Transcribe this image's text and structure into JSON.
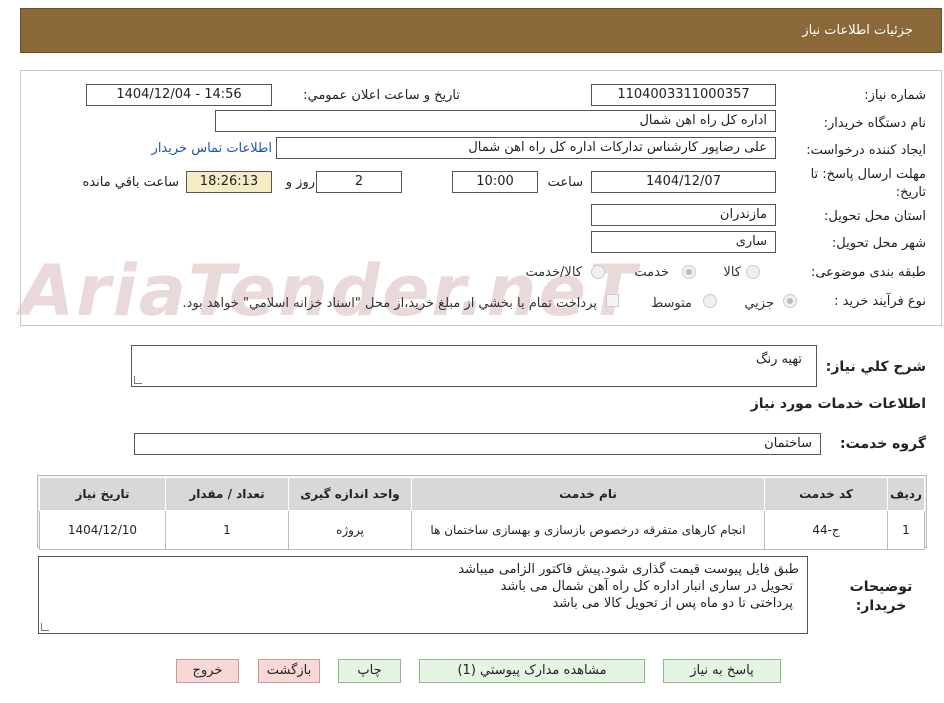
{
  "header": {
    "title": "جزئيات اطلاعات نياز"
  },
  "watermark": "AriaTender.neT",
  "fields": {
    "need_number_label": "شماره نياز:",
    "need_number": "1104003311000357",
    "announce_label": "تاريخ و ساعت اعلان عمومي:",
    "announce_value": "1404/12/04 - 14:56",
    "buyer_org_label": "نام دستگاه خريدار:",
    "buyer_org": "اداره كل راه اهن شمال",
    "creator_label": "ايجاد كننده درخواست:",
    "creator": "علی رضاپور کارشناس تدارکات اداره کل راه اهن شمال",
    "contact_link": "اطلاعات تماس خريدار",
    "deadline_label": "مهلت ارسال پاسخ: تا تاريخ:",
    "deadline_date": "1404/12/07",
    "time_label": "ساعت",
    "deadline_time": "10:00",
    "days": "2",
    "days_label": "روز و",
    "remaining_time": "18:26:13",
    "remaining_label": "ساعت باقي مانده",
    "province_label": "استان محل تحويل:",
    "province": "مازندران",
    "city_label": "شهر محل تحويل:",
    "city": "ساری",
    "category_label": "طبقه بندی موضوعی:",
    "category_options": [
      "كالا",
      "خدمت",
      "كالا/خدمت"
    ],
    "process_label": "نوع فرآيند خريد :",
    "process_options": [
      "جزيي",
      "متوسط"
    ],
    "payment_note": "پرداخت تمام يا بخشي از مبلغ خريد،از محل \"اسناد خزانه اسلامي\" خواهد بود."
  },
  "summary": {
    "label": "شرح كلي نياز:",
    "value": "تهیه رنگ"
  },
  "services_title": "اطلاعات خدمات مورد نياز",
  "service_group": {
    "label": "گروه خدمت:",
    "value": "ساختمان"
  },
  "table": {
    "headers": [
      "رديف",
      "كد خدمت",
      "نام خدمت",
      "واحد اندازه گيری",
      "تعداد / مقدار",
      "تاريخ نياز"
    ],
    "rows": [
      [
        "1",
        "ج-44",
        "انجام کارهای متفرقه درخصوص بازسازی و بهسازی ساختمان ها",
        "پروژه",
        "1",
        "1404/12/10"
      ]
    ]
  },
  "buyer_notes": {
    "label": "توضيحات خريدار:",
    "lines": [
      "طبق فایل پیوست قیمت گذاری شود.پیش فاکتور الزامی میباشد",
      "تحویل در ساری انبار اداره کل راه آهن شمال می باشد",
      "پرداختی تا دو ماه پس از تحویل کالا می باشد"
    ]
  },
  "buttons": {
    "reply": "پاسخ به نياز",
    "attachments": "مشاهده مدارک پيوستي (1)",
    "print": "چاپ",
    "back": "بازگشت",
    "exit": "خروج"
  },
  "colors": {
    "header_bg": "#8b6838",
    "link": "#1a56b0",
    "timer_bg": "#f3ecc4"
  }
}
